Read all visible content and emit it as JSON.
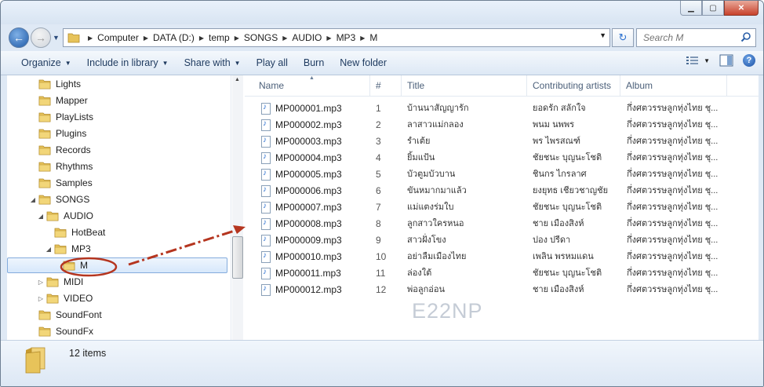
{
  "window": {
    "controls": {
      "minimize": "▁",
      "maximize": "▢",
      "close": "✕"
    }
  },
  "address": {
    "crumbs": [
      "Computer",
      "DATA (D:)",
      "temp",
      "SONGS",
      "AUDIO",
      "MP3",
      "M"
    ],
    "search_placeholder": "Search M"
  },
  "toolbar": {
    "organize": "Organize",
    "include_in_library": "Include in library",
    "share_with": "Share with",
    "play_all": "Play all",
    "burn": "Burn",
    "new_folder": "New folder"
  },
  "tree": {
    "items": [
      {
        "label": "Lights",
        "level": 0,
        "arrow": ""
      },
      {
        "label": "Mapper",
        "level": 0,
        "arrow": ""
      },
      {
        "label": "PlayLists",
        "level": 0,
        "arrow": ""
      },
      {
        "label": "Plugins",
        "level": 0,
        "arrow": ""
      },
      {
        "label": "Records",
        "level": 0,
        "arrow": ""
      },
      {
        "label": "Rhythms",
        "level": 0,
        "arrow": ""
      },
      {
        "label": "Samples",
        "level": 0,
        "arrow": ""
      },
      {
        "label": "SONGS",
        "level": 0,
        "arrow": "◢"
      },
      {
        "label": "AUDIO",
        "level": 1,
        "arrow": "◢"
      },
      {
        "label": "HotBeat",
        "level": 2,
        "arrow": ""
      },
      {
        "label": "MP3",
        "level": 2,
        "arrow": "◢"
      },
      {
        "label": "M",
        "level": 3,
        "arrow": "",
        "selected": true
      },
      {
        "label": "MIDI",
        "level": 1,
        "arrow": "▷"
      },
      {
        "label": "VIDEO",
        "level": 1,
        "arrow": "▷"
      },
      {
        "label": "SoundFont",
        "level": 0,
        "arrow": ""
      },
      {
        "label": "SoundFx",
        "level": 0,
        "arrow": ""
      }
    ]
  },
  "columns": {
    "name": "Name",
    "number": "#",
    "title": "Title",
    "artists": "Contributing artists",
    "album": "Album"
  },
  "files": [
    {
      "name": "MP000001.mp3",
      "num": "1",
      "title": "บ้านนาสัญญารัก",
      "artist": "ยอดรัก สลักใจ",
      "album": "กึ่งศตวรรษลูกทุ่งไทย ชุ..."
    },
    {
      "name": "MP000002.mp3",
      "num": "2",
      "title": "ลาสาวแม่กลอง",
      "artist": "พนม นพพร",
      "album": "กึ่งศตวรรษลูกทุ่งไทย ชุ..."
    },
    {
      "name": "MP000003.mp3",
      "num": "3",
      "title": "รำเต้ย",
      "artist": "พร ไพรสณฑ์",
      "album": "กึ่งศตวรรษลูกทุ่งไทย ชุ..."
    },
    {
      "name": "MP000004.mp3",
      "num": "4",
      "title": "ยิ้มแป้น",
      "artist": "ชัยชนะ บุญนะโชติ",
      "album": "กึ่งศตวรรษลูกทุ่งไทย ชุ..."
    },
    {
      "name": "MP000005.mp3",
      "num": "5",
      "title": "บัวตูมบัวบาน",
      "artist": "ชินกร ไกรลาศ",
      "album": "กึ่งศตวรรษลูกทุ่งไทย ชุ..."
    },
    {
      "name": "MP000006.mp3",
      "num": "6",
      "title": "ขันหมากมาแล้ว",
      "artist": "ยงยุทธ เชียวชาญชัย",
      "album": "กึ่งศตวรรษลูกทุ่งไทย ชุ..."
    },
    {
      "name": "MP000007.mp3",
      "num": "7",
      "title": "แม่แตงร่มใบ",
      "artist": "ชัยชนะ บุญนะโชติ",
      "album": "กึ่งศตวรรษลูกทุ่งไทย ชุ..."
    },
    {
      "name": "MP000008.mp3",
      "num": "8",
      "title": "ลูกสาวใครหนอ",
      "artist": "ชาย เมืองสิงห์",
      "album": "กึ่งศตวรรษลูกทุ่งไทย ชุ..."
    },
    {
      "name": "MP000009.mp3",
      "num": "9",
      "title": "สาวฝั่งโขง",
      "artist": "ปอง ปรีดา",
      "album": "กึ่งศตวรรษลูกทุ่งไทย ชุ..."
    },
    {
      "name": "MP000010.mp3",
      "num": "10",
      "title": "อย่าลืมเมืองไทย",
      "artist": "เพลิน พรหมแดน",
      "album": "กึ่งศตวรรษลูกทุ่งไทย ชุ..."
    },
    {
      "name": "MP000011.mp3",
      "num": "11",
      "title": "ล่องใต้",
      "artist": "ชัยชนะ บุญนะโชติ",
      "album": "กึ่งศตวรรษลูกทุ่งไทย ชุ..."
    },
    {
      "name": "MP000012.mp3",
      "num": "12",
      "title": "พ่อลูกอ่อน",
      "artist": "ชาย เมืองสิงห์",
      "album": "กึ่งศตวรรษลูกทุ่งไทย ชุ..."
    }
  ],
  "watermark": "E22NP",
  "status": {
    "count": "12 items"
  },
  "colors": {
    "annotation": "#b5351f",
    "accent": "#2a6fcf",
    "folder": "#e7c35a"
  }
}
